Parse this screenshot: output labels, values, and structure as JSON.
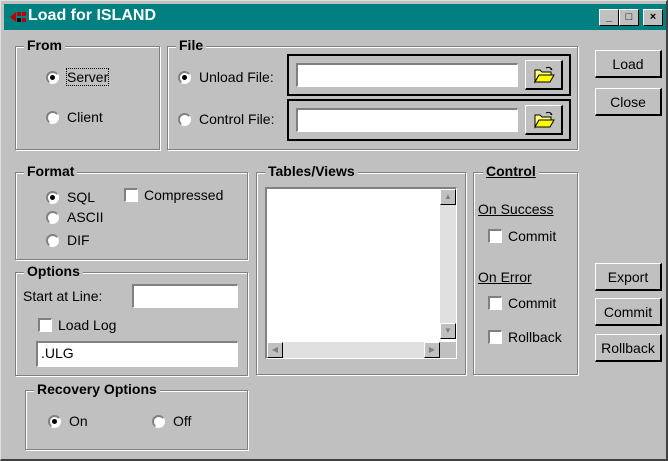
{
  "window": {
    "title": "Load for ISLAND",
    "minimize": "_",
    "maximize": "□",
    "close": "×"
  },
  "from": {
    "title": "From",
    "server_label": "Server",
    "client_label": "Client",
    "selected": "Server"
  },
  "file": {
    "title": "File",
    "unload_label": "Unload File:",
    "unload_value": "",
    "control_label": "Control File:",
    "control_value": "",
    "selected": "Unload File"
  },
  "format": {
    "title": "Format",
    "sql_label": "SQL",
    "ascii_label": "ASCII",
    "dif_label": "DIF",
    "compressed_label": "Compressed",
    "selected": "SQL"
  },
  "tables_views": {
    "title": "Tables/Views",
    "items": []
  },
  "control": {
    "title": "Control",
    "on_success_label": "On Success",
    "success_commit_label": "Commit",
    "on_error_label": "On Error",
    "error_commit_label": "Commit",
    "error_rollback_label": "Rollback"
  },
  "options": {
    "title": "Options",
    "start_at_line_label": "Start at Line:",
    "start_at_line_value": "",
    "load_log_label": "Load Log",
    "log_file_value": ".ULG"
  },
  "recovery": {
    "title": "Recovery Options",
    "on_label": "On",
    "off_label": "Off",
    "selected": "On"
  },
  "buttons": {
    "load": "Load",
    "close": "Close",
    "export": "Export",
    "commit": "Commit",
    "rollback": "Rollback"
  },
  "colors": {
    "titlebar": "#008080",
    "face": "#c0c0c0"
  }
}
